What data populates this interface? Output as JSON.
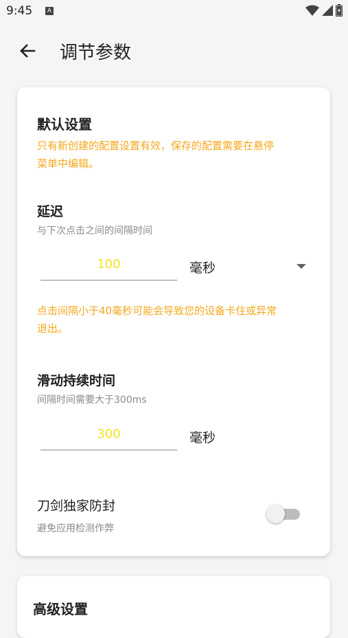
{
  "status": {
    "time": "9:45",
    "notif_glyph": "A"
  },
  "appbar": {
    "title": "调节参数",
    "back_icon": "arrow-left-icon"
  },
  "default_settings": {
    "title": "默认设置",
    "notice_line1": "只有新创建的配置设置有效，保存的配置需要在悬停",
    "notice_line2": "菜单中编辑。"
  },
  "delay": {
    "title": "延迟",
    "desc": "与下次点击之间的间隔时间",
    "value": "100",
    "unit": "毫秒",
    "warning_line1": "点击间隔小于40毫秒可能会导致您的设备卡住或异常",
    "warning_line2": "退出。"
  },
  "swipe": {
    "title": "滑动持续时间",
    "desc": "间隔时间需要大于300ms",
    "value": "300",
    "unit": "毫秒"
  },
  "anti_ban": {
    "title": "刀剑独家防封",
    "desc": "避免应用检测作弊",
    "enabled": false
  },
  "advanced": {
    "title": "高级设置"
  },
  "colors": {
    "accent_warning": "#f4a81d",
    "input_value": "#f5e51a"
  }
}
